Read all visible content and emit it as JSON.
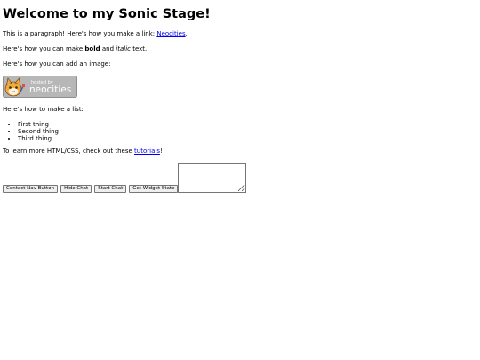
{
  "heading": "Welcome to my Sonic Stage!",
  "para_link": {
    "before": "This is a paragraph! Here's how you make a link: ",
    "link_text": "Neocities",
    "after": "."
  },
  "para_format": {
    "before": "Here's how you can make ",
    "bold": "bold",
    "middle": " and ",
    "italic": "italic",
    "after": " text."
  },
  "para_image": "Here's how you can add an image:",
  "badge": {
    "small_text": "hosted by",
    "big_text": "neocities"
  },
  "para_list": "Here's how to make a list:",
  "list_items": [
    "First thing",
    "Second thing",
    "Third thing"
  ],
  "para_learn": {
    "before": "To learn more HTML/CSS, check out these ",
    "link_text": "tutorials",
    "after": "!"
  },
  "buttons": {
    "contact_nav": "Contact Nav Button",
    "hide_chat": "Hide Chat",
    "start_chat": "Start Chat",
    "get_widget_state": "Get Widget State"
  },
  "textarea_value": ""
}
